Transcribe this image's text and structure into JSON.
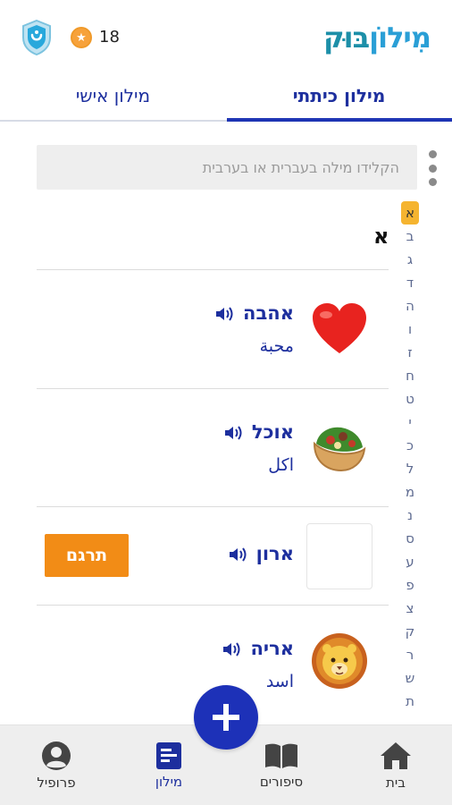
{
  "header": {
    "logo_part1": "מִילוֹן",
    "logo_part2": "בּוּק",
    "coins": "18",
    "shield_icon": "shield-icon",
    "coin_icon": "star-coin-icon"
  },
  "tabs": [
    {
      "label": "מילון כיתתי",
      "active": true
    },
    {
      "label": "מילון אישי",
      "active": false
    }
  ],
  "search": {
    "placeholder": "הקלידו מילה בעברית או בערבית"
  },
  "letter_header": "א",
  "alphabet": [
    "א",
    "ב",
    "ג",
    "ד",
    "ה",
    "ו",
    "ז",
    "ח",
    "ט",
    "י",
    "כ",
    "ל",
    "מ",
    "נ",
    "ס",
    "ע",
    "פ",
    "צ",
    "ק",
    "ר",
    "ש",
    "ת"
  ],
  "words": [
    {
      "hebrew": "אהבה",
      "arabic": "محبة",
      "image": "red-heart-emoji"
    },
    {
      "hebrew": "אוכל",
      "arabic": "اكل",
      "image": "stuffed-flatbread-emoji"
    },
    {
      "hebrew": "ארון",
      "arabic": "",
      "image": "",
      "action": "תרגם"
    },
    {
      "hebrew": "אריה",
      "arabic": "اسد",
      "image": "lion-face-emoji"
    }
  ],
  "nav": [
    {
      "label": "בית",
      "icon": "home-icon"
    },
    {
      "label": "סיפורים",
      "icon": "book-icon"
    },
    {
      "label": "מילון",
      "icon": "dictionary-icon",
      "active": true
    },
    {
      "label": "פרופיל",
      "icon": "profile-icon"
    }
  ],
  "colors": {
    "primary": "#1d2f9e",
    "accent": "#f28c16",
    "fab": "#1d31b8",
    "alpha_active": "#f5b430"
  }
}
